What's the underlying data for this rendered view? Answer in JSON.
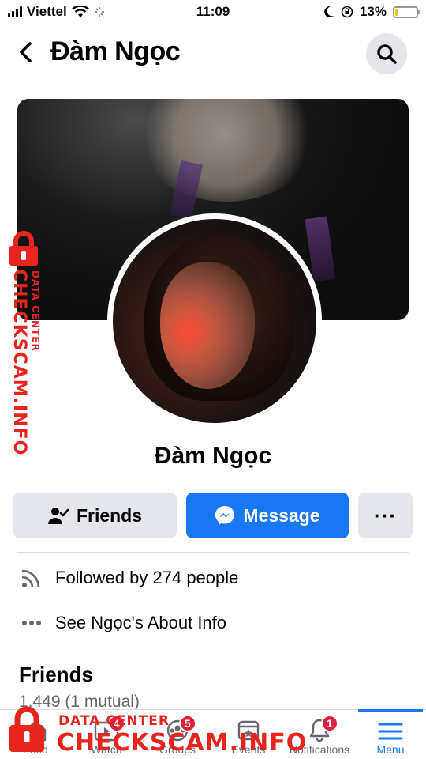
{
  "status_bar": {
    "carrier": "Viettel",
    "time": "11:09",
    "battery": "13%",
    "battery_level": 0.13,
    "icons": [
      "signal-icon",
      "wifi-icon",
      "loading-icon",
      "moon-icon",
      "orientation-lock-icon",
      "battery-icon"
    ]
  },
  "header": {
    "title": "Đàm Ngọc",
    "icons": [
      "back-icon",
      "search-icon"
    ]
  },
  "profile": {
    "name": "Đàm Ngọc"
  },
  "actions": {
    "friends_label": "Friends",
    "message_label": "Message",
    "more_label": "···"
  },
  "info": {
    "followed_by": "Followed by 274 people",
    "about": "See Ngọc's About Info"
  },
  "friends_section": {
    "title": "Friends",
    "count": "1,449 (1 mutual)"
  },
  "tabbar": {
    "tabs": [
      {
        "label": "Feed",
        "icon": "home-icon",
        "badge": ""
      },
      {
        "label": "Watch",
        "icon": "watch-icon",
        "badge": "4"
      },
      {
        "label": "Groups",
        "icon": "groups-icon",
        "badge": "5"
      },
      {
        "label": "Events",
        "icon": "events-icon",
        "badge": ""
      },
      {
        "label": "Notifications",
        "icon": "bell-icon",
        "badge": "1"
      },
      {
        "label": "Menu",
        "icon": "menu-icon",
        "badge": ""
      }
    ],
    "active": "Menu"
  },
  "watermark": {
    "brand": "CHECKSCAM.INFO",
    "tagline": "DATA CENTER"
  },
  "colors": {
    "accent": "#1877f2",
    "badge": "#e41e3f",
    "watermark": "#e8241f"
  }
}
